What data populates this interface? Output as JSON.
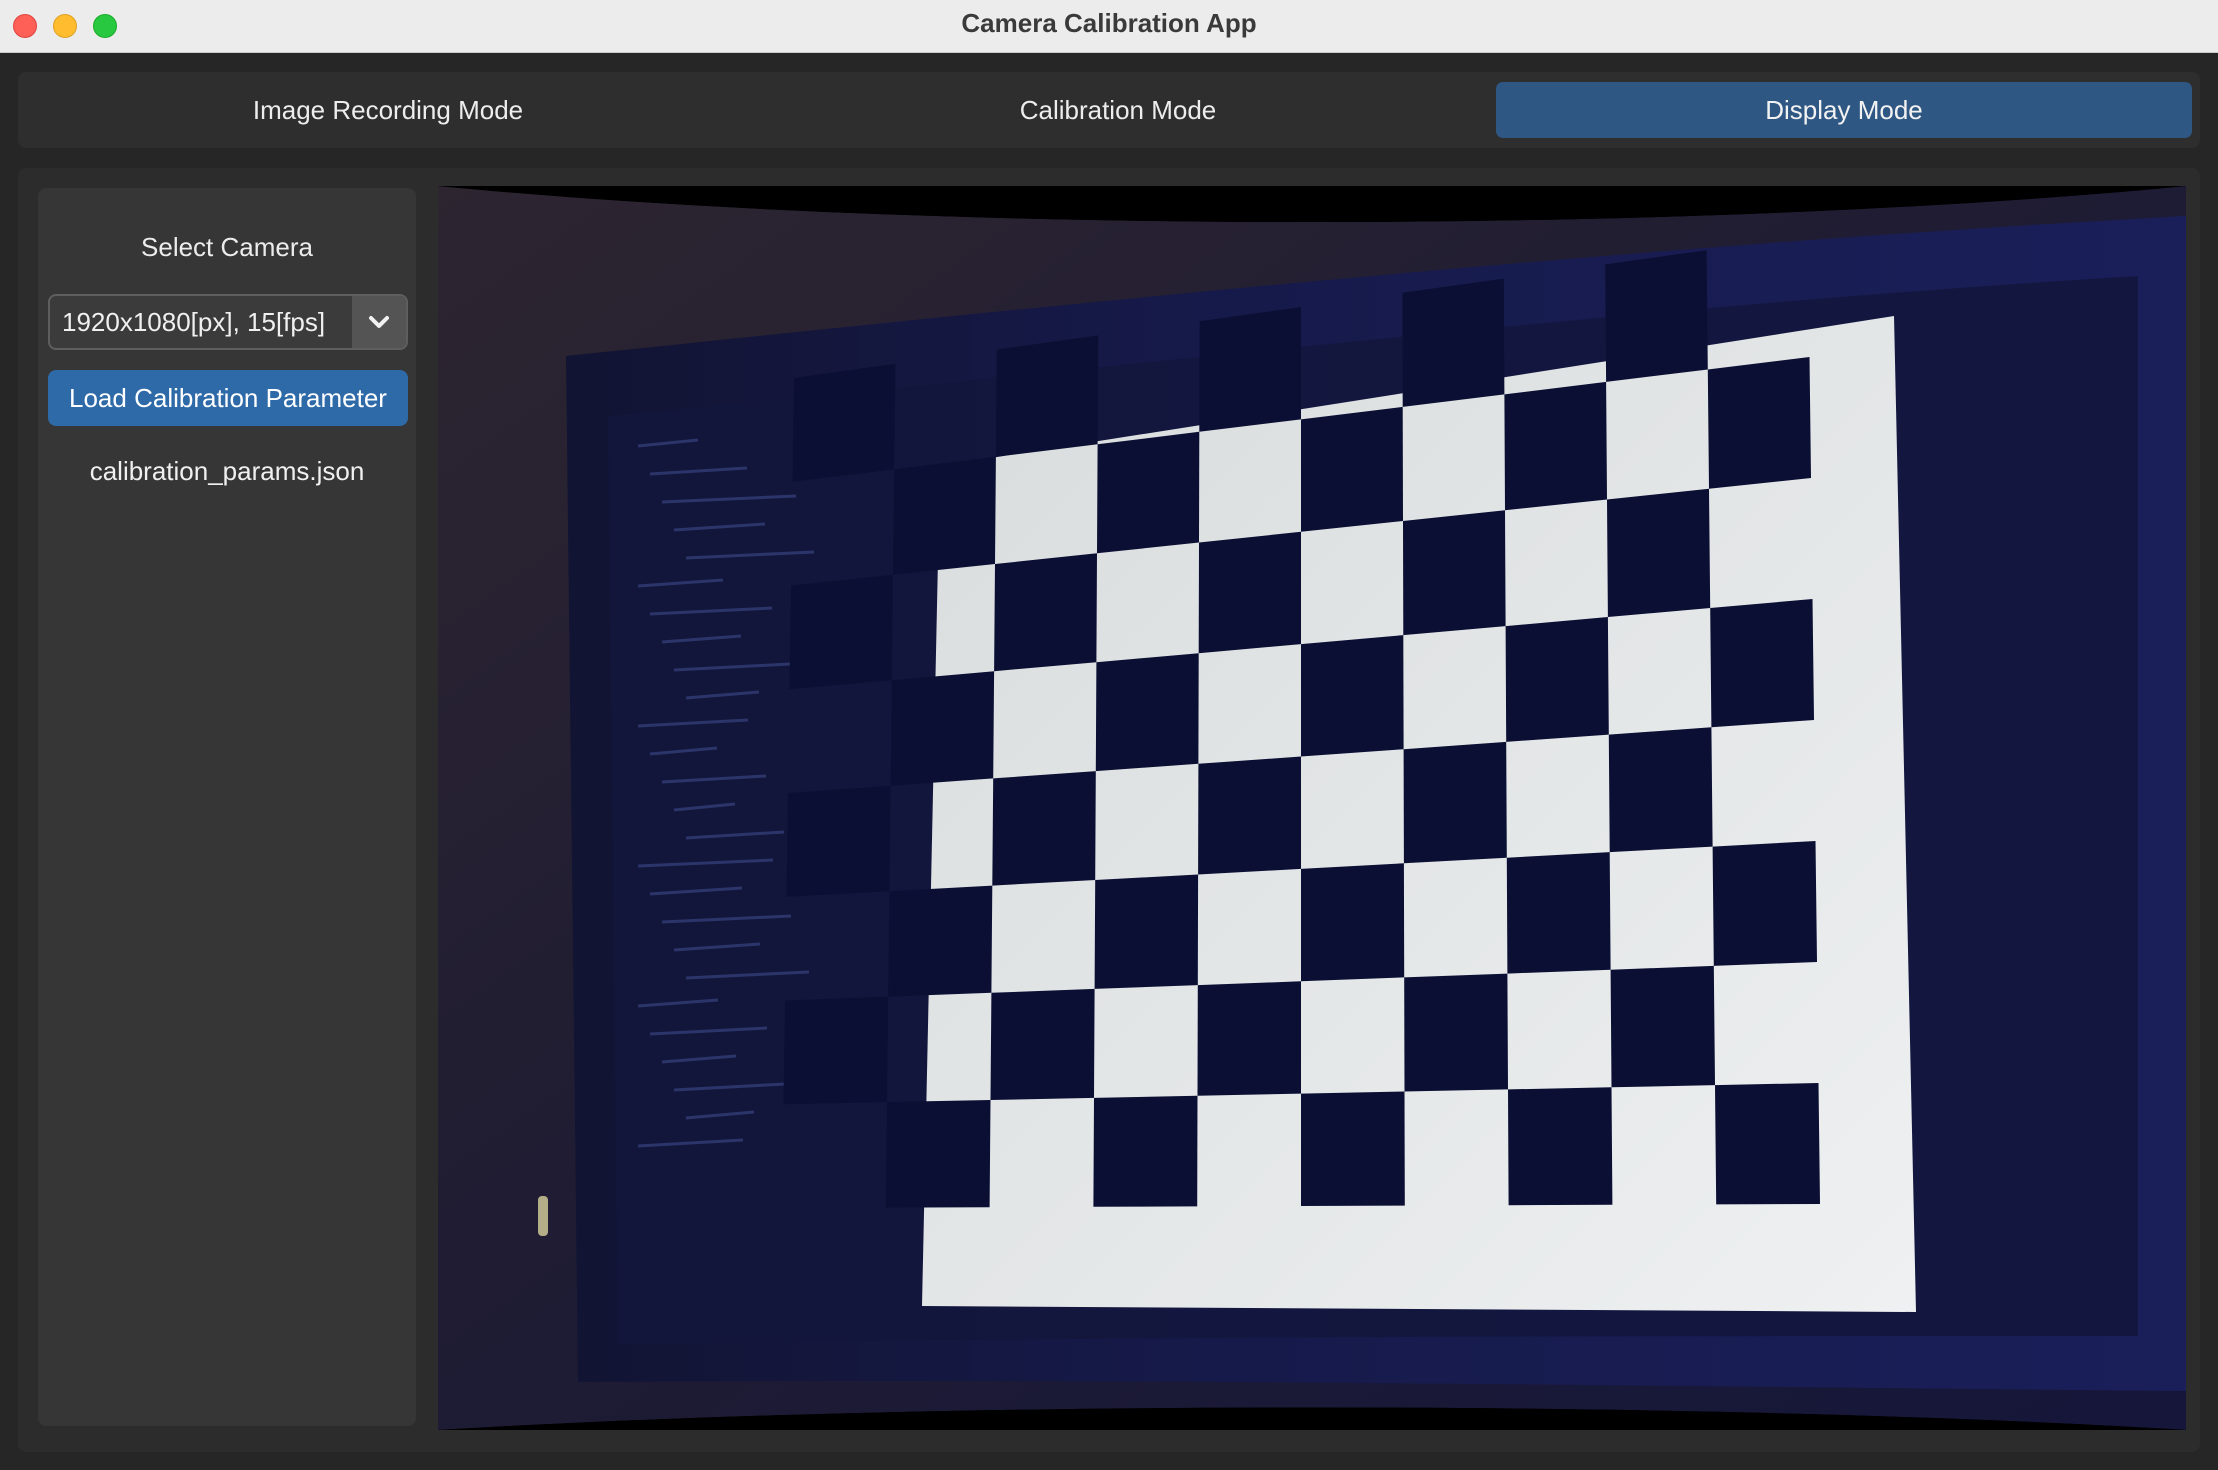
{
  "window": {
    "title": "Camera Calibration App"
  },
  "tabs": [
    {
      "label": "Image Recording Mode",
      "active": false
    },
    {
      "label": "Calibration Mode",
      "active": false
    },
    {
      "label": "Display Mode",
      "active": true
    }
  ],
  "sidebar": {
    "title": "Select Camera",
    "camera_select": {
      "value": "1920x1080[px], 15[fps]",
      "icon": "chevron-down-icon"
    },
    "load_button_label": "Load Calibration Parameter",
    "loaded_file": "calibration_params.json"
  },
  "camera_view": {
    "content": "undistorted live camera frame showing a chessboard calibration pattern on a monitor",
    "chessboard": {
      "rows": 8,
      "cols": 10
    }
  },
  "colors": {
    "active_tab": "#2e5783",
    "primary_button": "#2e6aa8",
    "background": "#262626",
    "panel": "#363636"
  }
}
